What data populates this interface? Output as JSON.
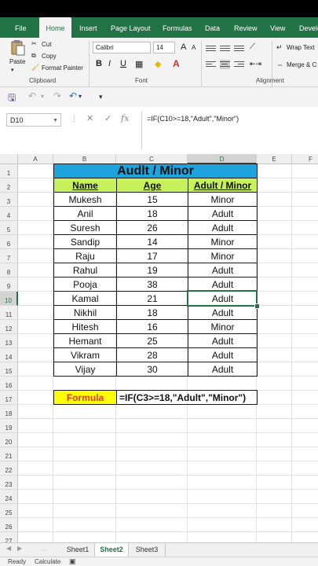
{
  "ribbon_tabs": [
    "File",
    "Home",
    "Insert",
    "Page Layout",
    "Formulas",
    "Data",
    "Review",
    "View",
    "Develo"
  ],
  "active_tab": "Home",
  "clipboard": {
    "paste": "Paste",
    "cut": "Cut",
    "copy": "Copy",
    "format_painter": "Format Painter",
    "group_label": "Clipboard"
  },
  "font": {
    "name": "Calibri",
    "size": "14",
    "bold": "B",
    "italic": "I",
    "underline": "U",
    "grow": "A",
    "shrink": "A",
    "group_label": "Font"
  },
  "alignment": {
    "wrap_text": "Wrap Text",
    "merge_center": "Merge & C",
    "group_label": "Alignment"
  },
  "name_box": "D10",
  "formula_bar": "=IF(C10>=18,\"Adult\",\"Minor\")",
  "columns": [
    "A",
    "B",
    "C",
    "D",
    "E",
    "F"
  ],
  "rows": [
    "1",
    "2",
    "3",
    "4",
    "5",
    "6",
    "7",
    "8",
    "9",
    "10",
    "11",
    "12",
    "13",
    "14",
    "15",
    "16",
    "17",
    "18",
    "19",
    "20",
    "21",
    "22",
    "23",
    "24",
    "25",
    "26",
    "27"
  ],
  "table": {
    "title": "Audlt / Minor",
    "headers": [
      "Name",
      "Age",
      "Adult / Minor"
    ],
    "data": [
      [
        "Mukesh",
        "15",
        "Minor"
      ],
      [
        "Anil",
        "18",
        "Adult"
      ],
      [
        "Suresh",
        "26",
        "Adult"
      ],
      [
        "Sandip",
        "14",
        "Minor"
      ],
      [
        "Raju",
        "17",
        "Minor"
      ],
      [
        "Rahul",
        "19",
        "Adult"
      ],
      [
        "Pooja",
        "38",
        "Adult"
      ],
      [
        "Kamal",
        "21",
        "Adult"
      ],
      [
        "Nikhil",
        "18",
        "Adult"
      ],
      [
        "Hitesh",
        "16",
        "Minor"
      ],
      [
        "Hemant",
        "25",
        "Adult"
      ],
      [
        "Vikram",
        "28",
        "Adult"
      ],
      [
        "Vijay",
        "30",
        "Adult"
      ]
    ]
  },
  "formula_row": {
    "label": "Formula",
    "text": "=IF(C3>=18,\"Adult\",\"Minor\")"
  },
  "sheets": [
    "Sheet1",
    "Sheet2",
    "Sheet3"
  ],
  "active_sheet": "Sheet2",
  "status": {
    "ready": "Ready",
    "calculate": "Calculate"
  },
  "colors": {
    "excel_green": "#217346",
    "title_fill": "#1fa3dc",
    "header_fill": "#c8f05a",
    "formula_label_fill": "#ffff00",
    "formula_label_text": "#e53935"
  }
}
